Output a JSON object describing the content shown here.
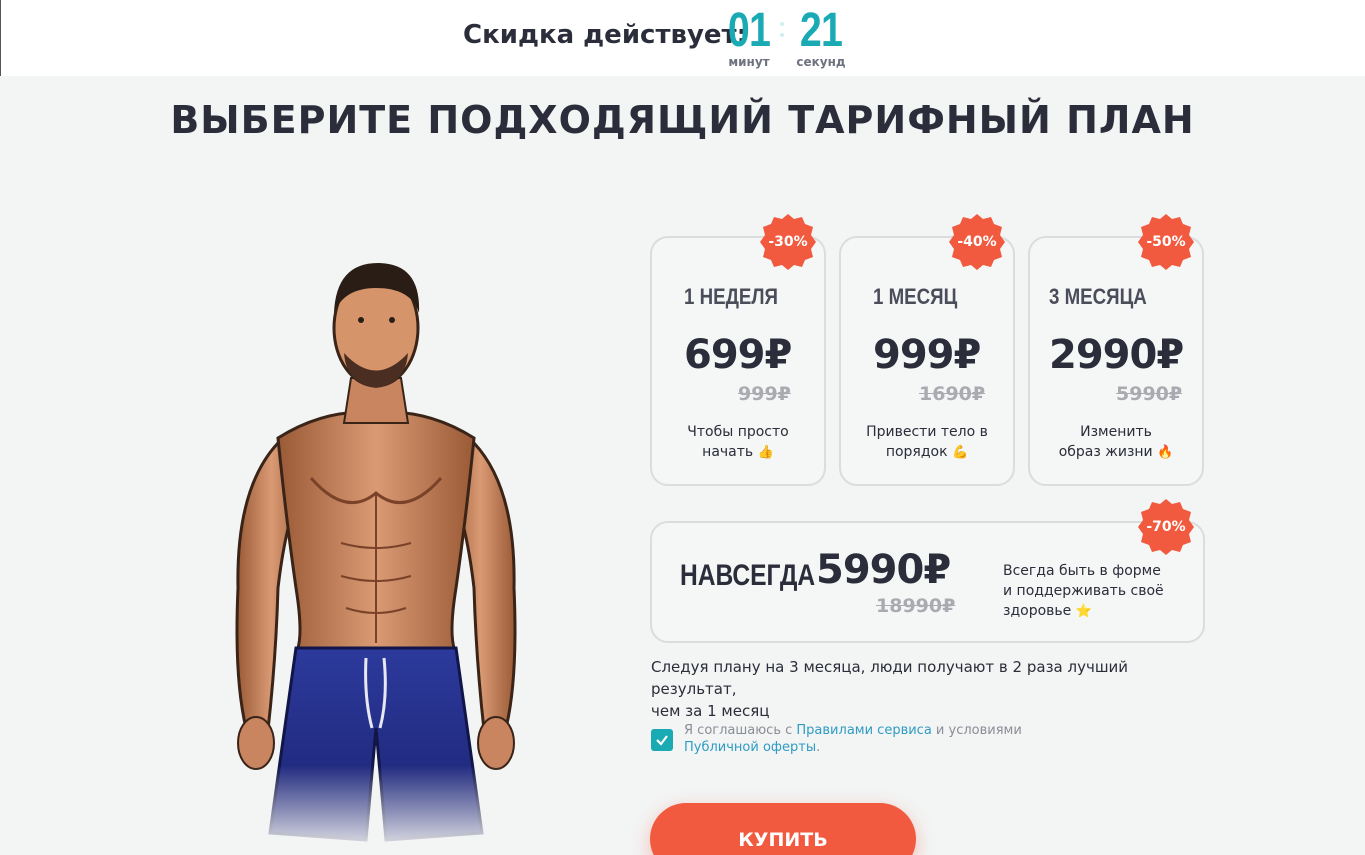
{
  "timer": {
    "label": "Скидка действует:",
    "minutes": "01",
    "minutes_unit": "минут",
    "seconds": "21",
    "seconds_unit": "секунд",
    "color": "#19aab4"
  },
  "page_title": "ВЫБЕРИТЕ ПОДХОДЯЩИЙ ТАРИФНЫЙ ПЛАН",
  "plans": [
    {
      "period": "1 НЕДЕЛЯ",
      "price": "699₽",
      "old_price": "999₽",
      "discount": "-30%",
      "desc1": "Чтобы просто",
      "desc2": "начать",
      "emoji": "👍"
    },
    {
      "period": "1 МЕСЯЦ",
      "price": "999₽",
      "old_price": "1690₽",
      "discount": "-40%",
      "desc1": "Привести тело в",
      "desc2": "порядок",
      "emoji": "💪"
    },
    {
      "period": "3 МЕСЯЦА",
      "price": "2990₽",
      "old_price": "5990₽",
      "discount": "-50%",
      "desc1": "Изменить",
      "desc2": "образ жизни",
      "emoji": "🔥"
    }
  ],
  "forever_plan": {
    "period": "НАВСЕГДА",
    "price": "5990₽",
    "old_price": "18990₽",
    "discount": "-70%",
    "desc1": "Всегда быть в форме",
    "desc2": "и поддерживать своё",
    "desc3": "здоровье",
    "emoji": "⭐"
  },
  "note_line1": "Следуя плану на 3 месяца, люди получают в 2 раза лучший результат,",
  "note_line2": "чем за 1 месяц",
  "agreement": {
    "checked": true,
    "text1": "Я соглашаюсь с ",
    "link1": "Правилами сервиса",
    "text2": " и условиями",
    "link2": "Публичной оферты",
    "text3": "."
  },
  "buy_label": "КУПИТЬ",
  "colors": {
    "accent": "#19aab4",
    "badge": "#f15a3e",
    "button": "#f15a3e",
    "text": "#2b2d3a"
  }
}
